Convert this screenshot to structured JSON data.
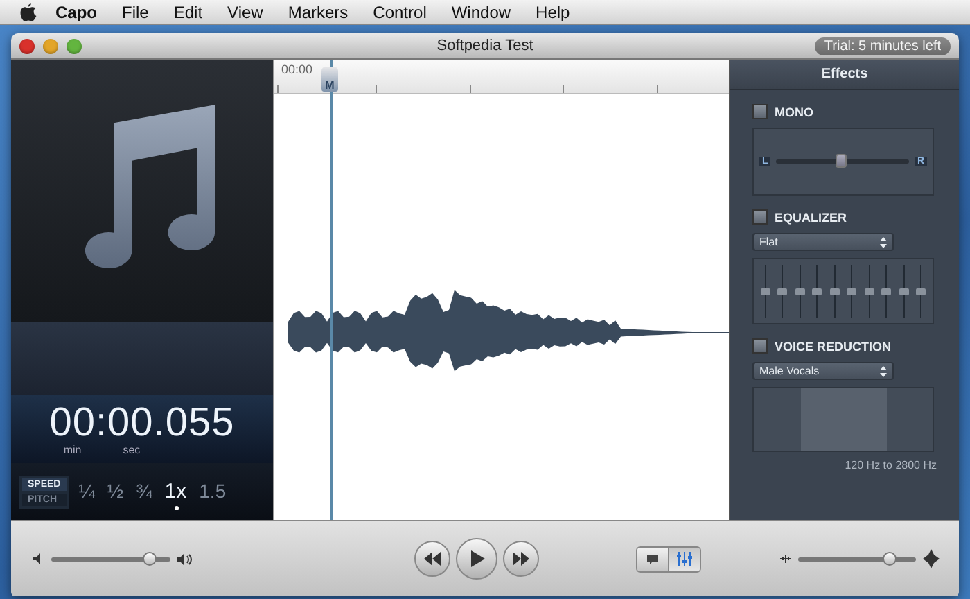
{
  "menu_bar": {
    "items": [
      {
        "label": "Capo",
        "kind": "app"
      },
      {
        "label": "File",
        "kind": "menu"
      },
      {
        "label": "Edit",
        "kind": "menu"
      },
      {
        "label": "View",
        "kind": "menu"
      },
      {
        "label": "Markers",
        "kind": "menu"
      },
      {
        "label": "Control",
        "kind": "menu"
      },
      {
        "label": "Window",
        "kind": "menu"
      },
      {
        "label": "Help",
        "kind": "menu"
      }
    ]
  },
  "window": {
    "title": "Softpedia Test",
    "trial_badge": "Trial: 5 minutes left"
  },
  "left_panel": {
    "time": "00:00.055",
    "units": [
      "min",
      "sec"
    ],
    "modes": [
      {
        "label": "SPEED",
        "selected": true
      },
      {
        "label": "PITCH",
        "selected": false
      }
    ],
    "rates": [
      {
        "label": "¼",
        "selected": false
      },
      {
        "label": "½",
        "selected": false
      },
      {
        "label": "¾",
        "selected": false
      },
      {
        "label": "1x",
        "selected": true
      },
      {
        "label": "1.5",
        "selected": false
      }
    ]
  },
  "timeline": {
    "start": "00:00",
    "marker": "M"
  },
  "effects": {
    "title": "Effects",
    "sections": [
      {
        "kind": "mono",
        "label": "MONO",
        "checked": false,
        "left": "L",
        "right": "R",
        "level": 0.5
      },
      {
        "kind": "equalizer",
        "label": "EQUALIZER",
        "checked": false,
        "preset": "Flat",
        "bands": [
          {
            "level": 0.5
          },
          {
            "level": 0.5
          },
          {
            "level": 0.5
          },
          {
            "level": 0.5
          },
          {
            "level": 0.5
          },
          {
            "level": 0.5
          },
          {
            "level": 0.5
          },
          {
            "level": 0.5
          },
          {
            "level": 0.5
          },
          {
            "level": 0.5
          }
        ]
      },
      {
        "kind": "voice_reduction",
        "label": "VOICE REDUCTION",
        "checked": false,
        "preset": "Male Vocals",
        "range": "120 Hz to 2800 Hz"
      }
    ]
  },
  "transport": {
    "volume": {
      "level": 0.83
    },
    "zoom": {
      "level": 0.78
    },
    "views": [
      {
        "kind": "notes",
        "selected": false
      },
      {
        "kind": "mixer",
        "selected": true
      }
    ]
  }
}
